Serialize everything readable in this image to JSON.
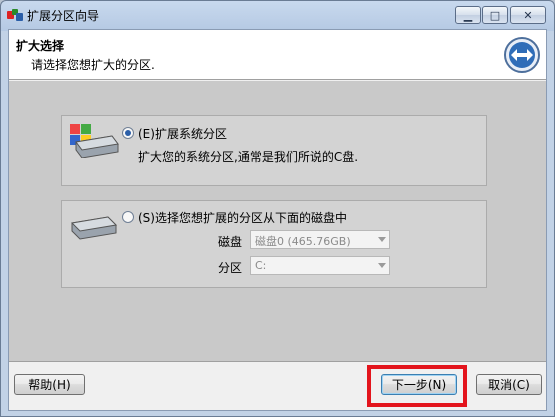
{
  "window": {
    "title": "扩展分区向导"
  },
  "header": {
    "title": "扩大选择",
    "subtitle": "请选择您想扩大的分区."
  },
  "option1": {
    "label": "(E)扩展系统分区",
    "description": "扩大您的系统分区,通常是我们所说的C盘.",
    "selected": true
  },
  "option2": {
    "label": "(S)选择您想扩展的分区从下面的磁盘中",
    "selected": false,
    "disk_label": "磁盘",
    "disk_value": "磁盘0 (465.76GB)",
    "partition_label": "分区",
    "partition_value": "C:"
  },
  "footer": {
    "help_label": "帮助(H)",
    "next_label": "下一步(N)",
    "cancel_label": "取消(C)"
  },
  "colors": {
    "highlight": "#e3141c",
    "accent": "#2a5ea8"
  }
}
